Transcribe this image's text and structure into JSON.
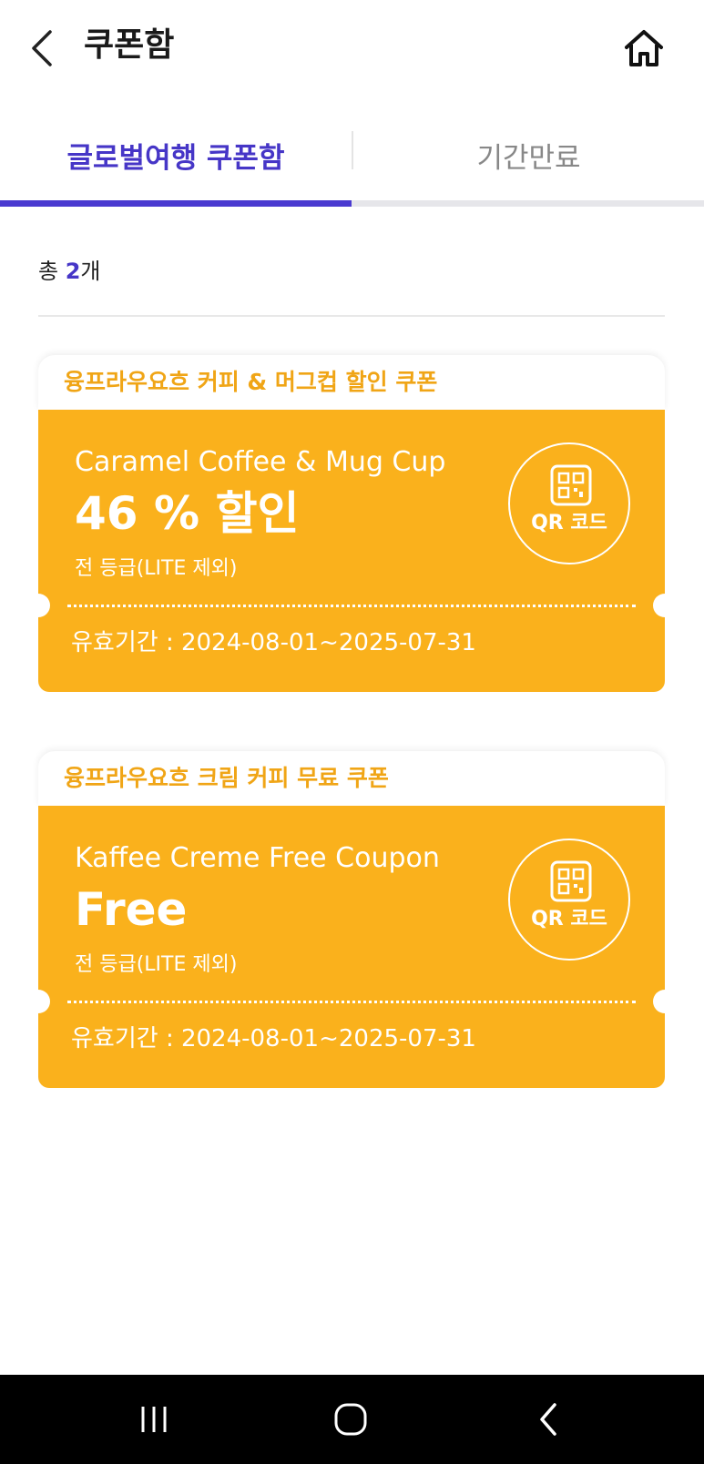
{
  "header": {
    "title": "쿠폰함",
    "back_icon": "chevron-left-icon",
    "home_icon": "home-icon"
  },
  "tabs": [
    {
      "label": "글로벌여행 쿠폰함",
      "active": true
    },
    {
      "label": "기간만료",
      "active": false
    }
  ],
  "summary": {
    "prefix": "총 ",
    "count": "2",
    "suffix": "개"
  },
  "coupons": [
    {
      "name": "융프라우요흐 커피 & 머그컵 할인 쿠폰",
      "subtitle": "Caramel Coffee & Mug Cup",
      "benefit": "46 % 할인",
      "grade": "전 등급(LITE 제외)",
      "qr_label": "QR 코드",
      "validity": "유효기간 : 2024-08-01~2025-07-31"
    },
    {
      "name": "융프라우요흐 크림 커피 무료 쿠폰",
      "subtitle": "Kaffee Creme Free Coupon",
      "benefit": "Free",
      "grade": "전 등급(LITE 제외)",
      "qr_label": "QR 코드",
      "validity": "유효기간 : 2024-08-01~2025-07-31"
    }
  ],
  "system_nav": {
    "recent_icon": "recent-apps-icon",
    "home_icon": "home-circle-icon",
    "back_icon": "back-icon"
  },
  "colors": {
    "accent": "#4a3ad0",
    "coupon": "#fab11c",
    "coupon_title": "#f0a516"
  }
}
